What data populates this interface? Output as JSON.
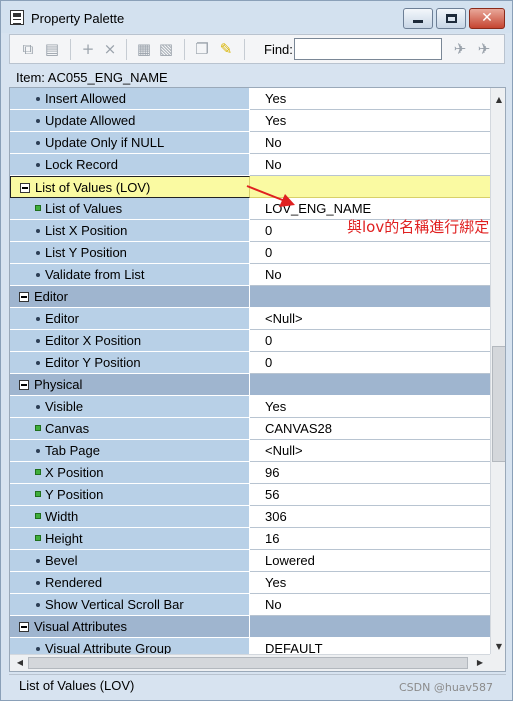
{
  "window": {
    "title": "Property Palette",
    "minimize_icon": "minimize-icon",
    "maximize_icon": "maximize-icon",
    "close_icon": "close-icon",
    "close_glyph": "✕"
  },
  "toolbar": {
    "find_label": "Find:",
    "find_value": "",
    "icons": [
      "copy-properties-icon",
      "paste-properties-icon",
      "add-property-icon",
      "delete-property-icon",
      "union-icon",
      "intersection-icon",
      "freeze-icon",
      "pin-icon",
      "find-next-icon",
      "find-previous-icon"
    ]
  },
  "item": {
    "label": "Item: AC055_ENG_NAME"
  },
  "grid": {
    "rows": [
      {
        "type": "prop",
        "marker": "dot",
        "name": "Insert Allowed",
        "value": "Yes"
      },
      {
        "type": "prop",
        "marker": "dot",
        "name": "Update Allowed",
        "value": "Yes"
      },
      {
        "type": "prop",
        "marker": "dot",
        "name": "Update Only if NULL",
        "value": "No"
      },
      {
        "type": "prop",
        "marker": "dot",
        "name": "Lock Record",
        "value": "No"
      },
      {
        "type": "category",
        "selected": true,
        "name": "List of Values (LOV)",
        "value": ""
      },
      {
        "type": "prop",
        "marker": "square",
        "name": "List of Values",
        "value": "LOV_ENG_NAME"
      },
      {
        "type": "prop",
        "marker": "dot",
        "name": "List X Position",
        "value": "0"
      },
      {
        "type": "prop",
        "marker": "dot",
        "name": "List Y Position",
        "value": "0"
      },
      {
        "type": "prop",
        "marker": "dot",
        "name": "Validate from List",
        "value": "No"
      },
      {
        "type": "category",
        "selected": false,
        "name": "Editor",
        "value": ""
      },
      {
        "type": "prop",
        "marker": "dot",
        "name": "Editor",
        "value": "<Null>"
      },
      {
        "type": "prop",
        "marker": "dot",
        "name": "Editor X Position",
        "value": "0"
      },
      {
        "type": "prop",
        "marker": "dot",
        "name": "Editor Y Position",
        "value": "0"
      },
      {
        "type": "category",
        "selected": false,
        "name": "Physical",
        "value": ""
      },
      {
        "type": "prop",
        "marker": "dot",
        "name": "Visible",
        "value": "Yes"
      },
      {
        "type": "prop",
        "marker": "square",
        "name": "Canvas",
        "value": "CANVAS28"
      },
      {
        "type": "prop",
        "marker": "dot",
        "name": "Tab Page",
        "value": "<Null>"
      },
      {
        "type": "prop",
        "marker": "square",
        "name": "X Position",
        "value": "96"
      },
      {
        "type": "prop",
        "marker": "square",
        "name": "Y Position",
        "value": "56"
      },
      {
        "type": "prop",
        "marker": "square",
        "name": "Width",
        "value": "306"
      },
      {
        "type": "prop",
        "marker": "square",
        "name": "Height",
        "value": "16"
      },
      {
        "type": "prop",
        "marker": "dot",
        "name": "Bevel",
        "value": "Lowered"
      },
      {
        "type": "prop",
        "marker": "dot",
        "name": "Rendered",
        "value": "Yes"
      },
      {
        "type": "prop",
        "marker": "dot",
        "name": "Show Vertical Scroll Bar",
        "value": "No"
      },
      {
        "type": "category",
        "selected": false,
        "name": "Visual Attributes",
        "value": ""
      },
      {
        "type": "prop",
        "marker": "dot",
        "name": "Visual Attribute Group",
        "value": "DEFAULT"
      }
    ],
    "scroll_up_glyph": "▲",
    "scroll_down_glyph": "▼",
    "scroll_left_glyph": "◀",
    "scroll_right_glyph": "▶"
  },
  "annotation": {
    "text": "與lov的名稱進行綁定",
    "color": "#e02020"
  },
  "status": {
    "text": "List of Values (LOV)"
  },
  "watermark": {
    "text": "CSDN @huav587"
  },
  "colors": {
    "property_name_bg": "#b8d0e7",
    "category_bg": "#9fb5cf",
    "selected_category_bg": "#fafaa2",
    "inherited_marker": "#3fae3a"
  }
}
